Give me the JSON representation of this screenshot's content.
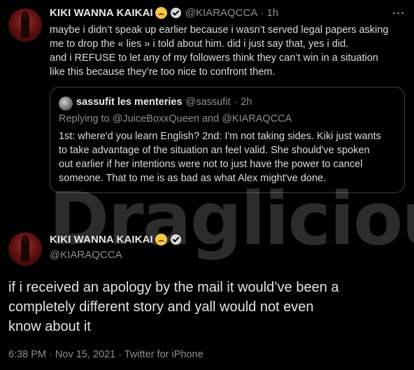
{
  "first_tweet": {
    "author_name": "KIKI WANNA KAIKAI",
    "author_emoji_icon": "pleading-face-emoji",
    "verified_icon": "verified-badge-icon",
    "author_handle": "@KIARAQCCA",
    "separator": "·",
    "time_ago": "1h",
    "more_label": "···",
    "text_lines": [
      "maybe i didn’t speak up earlier because i wasn’t served legal papers asking",
      "me to drop the « lies » i told about him. did i just say that, yes i did.",
      "and i REFUSE to let any of my followers think they can’t win in a situation",
      "like this because they’re too nice to confront them."
    ]
  },
  "quoted_tweet": {
    "author_name": "sassufit les menteries",
    "author_handle": "@sassufit",
    "separator": "·",
    "time_ago": "2h",
    "replying_prefix": "Replying to",
    "replying_user1": "@JuiceBoxxQueen",
    "replying_and": "and",
    "replying_user2": "@KIARAQCCA",
    "text_lines": [
      "1st: where'd you learn English? 2nd: I'm not taking sides. Kiki just wants",
      "to take advantage of the situation an feel valid. She should've spoken",
      "out earlier if her intentions were not to just have the power to cancel",
      "someone. That to me is as bad as what Alex might've done."
    ]
  },
  "watermark": {
    "text": "Draglicious"
  },
  "main_tweet": {
    "author_name": "KIKI WANNA KAIKAI",
    "author_handle": "@KIARAQCCA",
    "text_lines": [
      "if i received an apology by the mail it would’ve been a",
      "completely different story and yall would not even",
      "know about it"
    ],
    "timestamp": "6:38 PM",
    "date": "Nov 15, 2021",
    "source": "Twitter for iPhone",
    "separator": "·"
  },
  "colors": {
    "background": "#000000",
    "text": "#e4e4e4",
    "muted": "#8b8f94",
    "border": "#3a3d41"
  }
}
